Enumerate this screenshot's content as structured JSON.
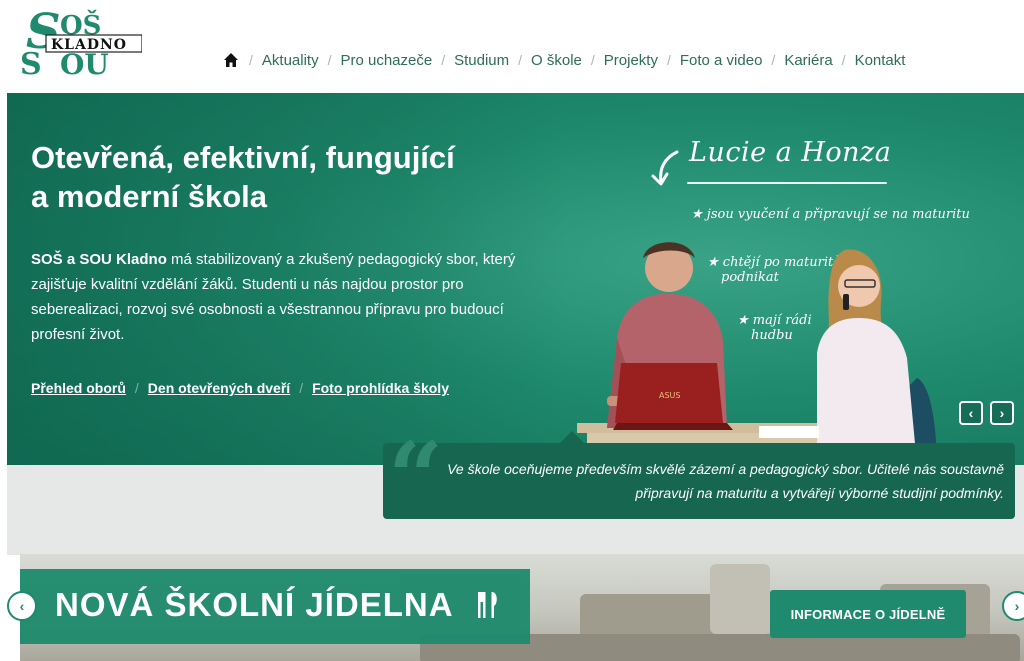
{
  "logo": {
    "top_letters": "SOŠ",
    "label": "KLADNO",
    "bottom_letters": "SOU"
  },
  "nav": {
    "items": [
      {
        "label": "Aktuality"
      },
      {
        "label": "Pro uchazeče"
      },
      {
        "label": "Studium"
      },
      {
        "label": "O škole"
      },
      {
        "label": "Projekty"
      },
      {
        "label": "Foto a video"
      },
      {
        "label": "Kariéra"
      },
      {
        "label": "Kontakt"
      }
    ],
    "separator": "/"
  },
  "hero": {
    "title_line1": "Otevřená, efektivní, fungující",
    "title_line2": "a moderní škola",
    "text_bold": "SOŠ a SOU Kladno",
    "text_rest": " má stabilizovaný a zkušený pedagogický sbor, který zajišťuje kvalitní vzdělání žáků. Studenti u nás najdou prostor pro seberealizaci, rozvoj své osobnosti a všestrannou přípravu pro budoucí profesní život.",
    "links": [
      {
        "label": "Přehled oborů"
      },
      {
        "label": "Den otevřených dveří"
      },
      {
        "label": "Foto prohlídka školy"
      }
    ],
    "chalk_title": "Lucie a Honza",
    "chalk_items": [
      "jsou vyučení a připravují se na maturitu",
      "chtějí po maturitě",
      "podnikat",
      "mají rádi",
      "hudbu"
    ],
    "laptop_brand": "ASUS",
    "prev_arrow": "‹",
    "next_arrow": "›"
  },
  "quote": {
    "marks": "“",
    "text": "Ve škole oceňujeme především skvělé zázemí a pedagogický sbor. Učitelé nás soustavně připravují na maturitu a vytvářejí výborné studijní podmínky."
  },
  "canteen": {
    "title": "NOVÁ ŠKOLNÍ JÍDELNA",
    "button_label": "INFORMACE O JÍDELNĚ",
    "prev_arrow": "‹",
    "next_arrow": "›"
  },
  "colors": {
    "brand_green": "#1f8a6d",
    "dark_green": "#17664f",
    "nav_text": "#2f6c5b"
  }
}
